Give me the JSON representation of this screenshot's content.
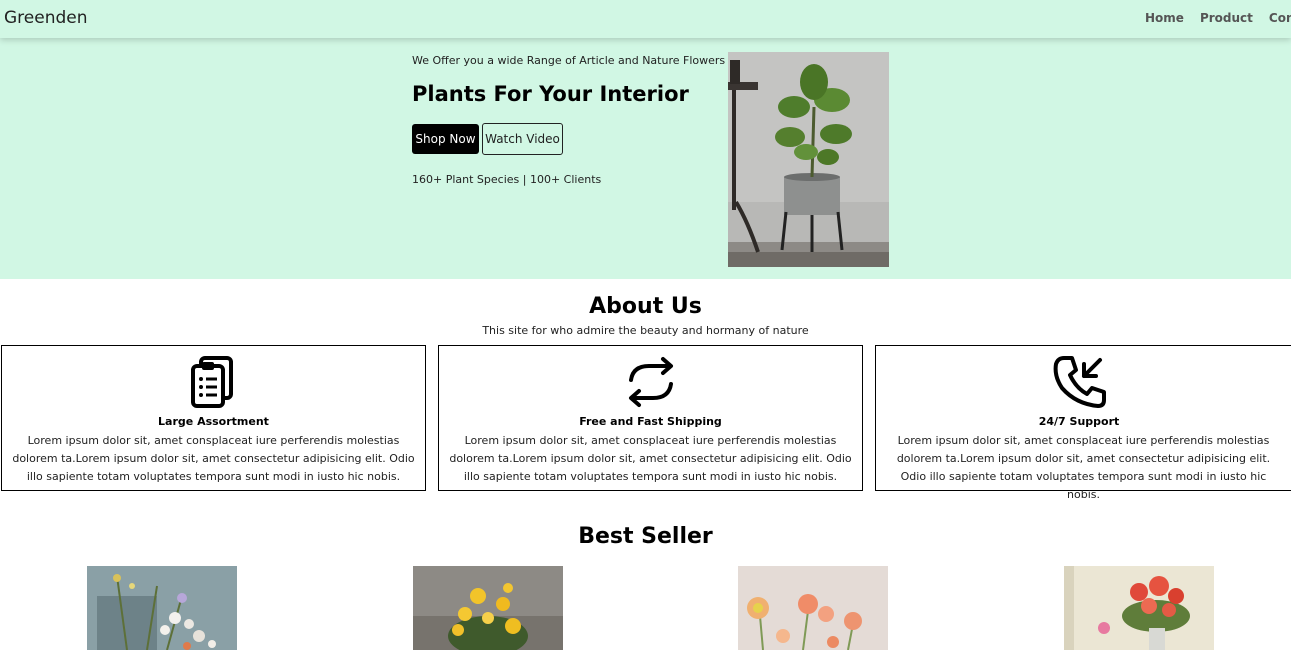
{
  "nav": {
    "brand": "Greenden",
    "links": [
      "Home",
      "Product",
      "Contact"
    ]
  },
  "hero": {
    "subtitle": "We Offer you a wide Range of Article and Nature Flowers",
    "title": "Plants For Your Interior",
    "shop_button": "Shop Now",
    "watch_button": "Watch Video",
    "stats": "160+ Plant Species | 100+ Clients",
    "image_icon": "potted-plant-image"
  },
  "about": {
    "title": "About Us",
    "subtitle": "This site for who admire the beauty and hormany of nature",
    "cards": [
      {
        "icon": "clipboard-list-icon",
        "title": "Large Assortment",
        "text": "Lorem ipsum dolor sit, amet consplaceat iure perferendis molestias dolorem ta.Lorem ipsum dolor sit, amet consectetur adipisicing elit. Odio illo sapiente totam voluptates tempora sunt modi in iusto hic nobis."
      },
      {
        "icon": "refresh-arrows-icon",
        "title": "Free and Fast Shipping",
        "text": "Lorem ipsum dolor sit, amet consplaceat iure perferendis molestias dolorem ta.Lorem ipsum dolor sit, amet consectetur adipisicing elit. Odio illo sapiente totam voluptates tempora sunt modi in iusto hic nobis."
      },
      {
        "icon": "phone-incoming-icon",
        "title": "24/7 Support",
        "text": "Lorem ipsum dolor sit, amet consplaceat iure perferendis molestias dolorem ta.Lorem ipsum dolor sit, amet consectetur adipisicing elit. Odio illo sapiente totam voluptates tempora sunt modi in iusto hic nobis."
      }
    ]
  },
  "best_seller": {
    "title": "Best Seller",
    "products": [
      {
        "image": "wildflowers-vase-image"
      },
      {
        "image": "yellow-flowers-pot-image"
      },
      {
        "image": "ranunculus-image"
      },
      {
        "image": "red-flowers-vase-image"
      }
    ]
  },
  "colors": {
    "hero_background": "#d1f7e4",
    "primary_button": "#000000"
  }
}
